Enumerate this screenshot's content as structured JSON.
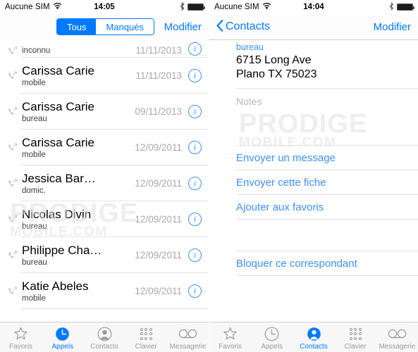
{
  "left_phone": {
    "status_bar": {
      "carrier": "Aucune SIM",
      "wifi_icon": "wifi-icon",
      "time": "14:05",
      "bluetooth_icon": "bluetooth-icon",
      "battery_icon": "battery-full-icon"
    },
    "nav": {
      "segmented": {
        "options": [
          "Tous",
          "Manqués"
        ],
        "selected": "Tous"
      },
      "edit_label": "Modifier"
    },
    "calls": [
      {
        "name": "",
        "subtitle": "inconnu",
        "date": "11/11/2013",
        "clipped": true
      },
      {
        "name": "Carissa Carie",
        "subtitle": "mobile",
        "date": "11/11/2013",
        "clipped": false
      },
      {
        "name": "Carissa Carie",
        "subtitle": "bureau",
        "date": "09/11/2013",
        "clipped": false
      },
      {
        "name": "Carissa Carie",
        "subtitle": "mobile",
        "date": "12/09/2011",
        "clipped": false
      },
      {
        "name": "Jessica Bar…",
        "subtitle": "domic.",
        "date": "12/09/2011",
        "clipped": false
      },
      {
        "name": "Nicolas Divin",
        "subtitle": "bureau",
        "date": "12/09/2011",
        "clipped": false
      },
      {
        "name": "Philippe Cha…",
        "subtitle": "bureau",
        "date": "12/09/2011",
        "clipped": false
      },
      {
        "name": "Katie Abeles",
        "subtitle": "mobile",
        "date": "12/09/2011",
        "clipped": false
      }
    ],
    "tabs": [
      {
        "label": "Favoris",
        "icon": "star-icon",
        "active": false
      },
      {
        "label": "Appels",
        "icon": "recents-clock-icon",
        "active": true
      },
      {
        "label": "Contacts",
        "icon": "contacts-person-icon",
        "active": false
      },
      {
        "label": "Clavier",
        "icon": "keypad-icon",
        "active": false
      },
      {
        "label": "Messagerie",
        "icon": "voicemail-icon",
        "active": false
      }
    ],
    "watermark": {
      "main": "PRODIGE",
      "sub": "MOBILE.COM"
    }
  },
  "right_phone": {
    "status_bar": {
      "carrier": "Aucune SIM",
      "wifi_icon": "wifi-icon",
      "time": "14:04",
      "bluetooth_icon": "bluetooth-icon",
      "battery_icon": "battery-full-icon"
    },
    "nav": {
      "back_label": "Contacts",
      "back_icon": "chevron-left-icon",
      "edit_label": "Modifier"
    },
    "address": {
      "label": "bureau",
      "street": "6715 Long Ave",
      "city_state_zip": "Plano TX 75023"
    },
    "notes": {
      "label": "Notes",
      "value": ""
    },
    "actions": [
      {
        "label": "Envoyer un message"
      },
      {
        "label": "Envoyer cette fiche"
      },
      {
        "label": "Ajouter aux favoris"
      }
    ],
    "block_action": {
      "label": "Bloquer ce correspondant"
    },
    "tabs": [
      {
        "label": "Favoris",
        "icon": "star-icon",
        "active": false
      },
      {
        "label": "Appels",
        "icon": "recents-clock-icon",
        "active": false
      },
      {
        "label": "Contacts",
        "icon": "contacts-person-icon",
        "active": true
      },
      {
        "label": "Clavier",
        "icon": "keypad-icon",
        "active": false
      },
      {
        "label": "Messagerie",
        "icon": "voicemail-icon",
        "active": false
      }
    ],
    "watermark": {
      "main": "PRODIGE",
      "sub": "MOBILE.COM"
    }
  },
  "colors": {
    "accent": "#007aff",
    "link": "#3b91f5",
    "muted": "#a8a8a8",
    "separator": "#e0e0e0"
  }
}
